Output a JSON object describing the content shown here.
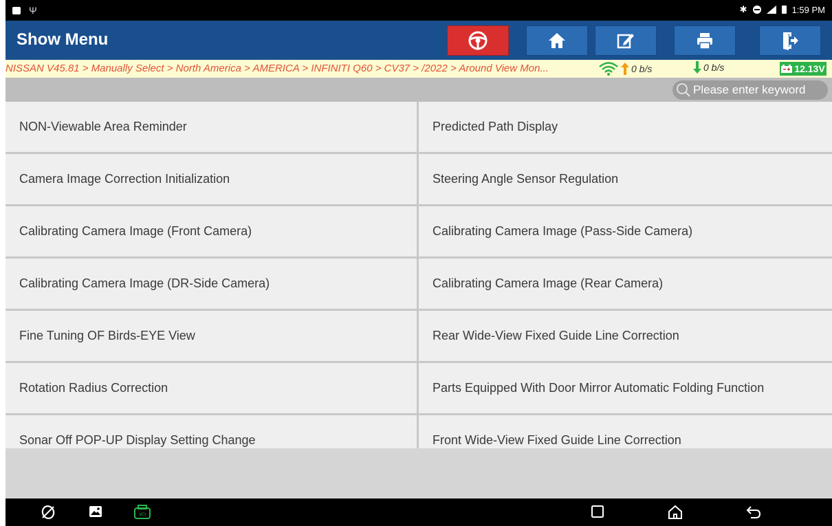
{
  "status_bar": {
    "time": "1:59 PM",
    "left_icons": [
      "gallery-notification-icon",
      "usb-icon"
    ],
    "right_icons": [
      "bluetooth-icon",
      "do-not-disturb-icon",
      "signal-icon",
      "battery-icon"
    ],
    "bluetooth_glyph": "✱"
  },
  "header": {
    "title": "Show Menu",
    "buttons": [
      "steering-wheel-icon",
      "home-icon",
      "edit-icon",
      "print-icon",
      "exit-icon"
    ]
  },
  "breadcrumb": {
    "path": "NISSAN V45.81 > Manually Select > North America > AMERICA > INFINITI Q60 > CV37 > /2022 > Around View Mon...",
    "upload_speed": "0 b/s",
    "download_speed": "0 b/s",
    "voltage": "12.13V"
  },
  "search": {
    "placeholder": "Please enter keyword",
    "value": ""
  },
  "menu": {
    "items": [
      "NON-Viewable Area Reminder",
      "Predicted Path  Display",
      "Camera Image Correction Initialization",
      "Steering Angle Sensor Regulation",
      "Calibrating Camera Image (Front Camera)",
      "Calibrating Camera Image (Pass-Side Camera)",
      "Calibrating Camera Image (DR-Side Camera)",
      "Calibrating Camera Image (Rear Camera)",
      "Fine Tuning OF Birds-EYE View",
      "Rear Wide-View Fixed Guide Line Correction",
      "Rotation Radius Correction",
      "Parts Equipped With Door Mirror Automatic Folding Function",
      "Sonar Off POP-UP Display Setting Change",
      "Front Wide-View Fixed Guide Line Correction"
    ]
  },
  "nav_bar": {
    "left": [
      "browser-icon",
      "gallery-icon",
      "vci-icon"
    ],
    "right": [
      "recents-icon",
      "home-icon",
      "back-icon"
    ]
  },
  "colors": {
    "header_bg": "#1a4f8e",
    "button_bg": "#2b6cb3",
    "accent_red": "#d9302f",
    "breadcrumb_text": "#e0533a",
    "voltage_bg": "#2db34a",
    "wifi": "#2db34a",
    "upload_arrow": "#f39c12"
  }
}
